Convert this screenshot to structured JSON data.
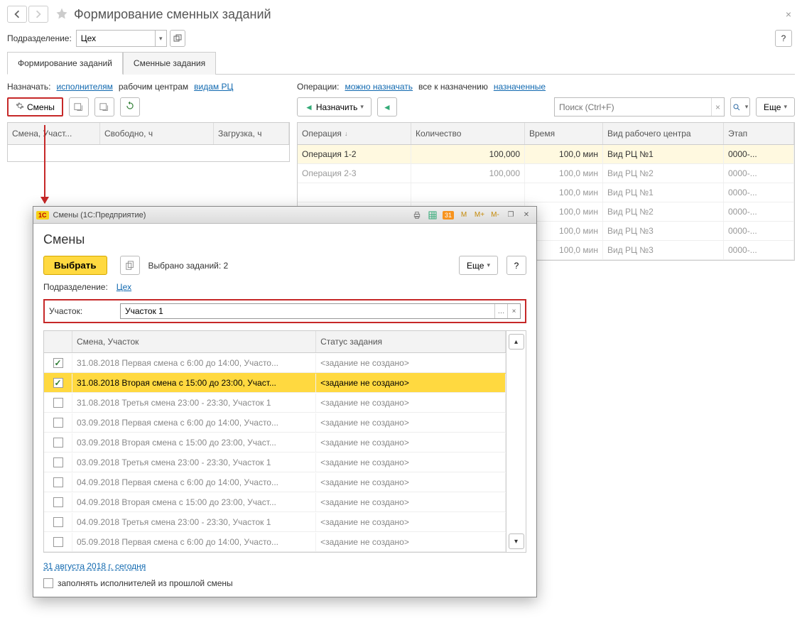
{
  "page": {
    "title": "Формирование сменных заданий",
    "close": "×"
  },
  "filter": {
    "label": "Подразделение:",
    "value": "Цех"
  },
  "help": "?",
  "tabs": {
    "tab1": "Формирование заданий",
    "tab2": "Сменные задания"
  },
  "left": {
    "assign_label": "Назначать:",
    "link_performers": "исполнителям",
    "link_workcenters": "рабочим центрам",
    "link_rctype": "видам РЦ",
    "btn_smeny": "Смены",
    "columns": {
      "shift": "Смена, Участ...",
      "free": "Свободно, ч",
      "load": "Загрузка, ч"
    }
  },
  "right": {
    "ops_label": "Операции:",
    "link_can_assign": "можно назначать",
    "txt_all": "все к назначению",
    "link_assigned": "назначенные",
    "btn_assign": "Назначить",
    "search_placeholder": "Поиск (Ctrl+F)",
    "btn_more": "Еще",
    "columns": {
      "op": "Операция",
      "qty": "Количество",
      "time": "Время",
      "rctype": "Вид рабочего центра",
      "stage": "Этап"
    },
    "rows": [
      {
        "op": "Операция 1-2",
        "qty": "100,000",
        "time": "100,0 мин",
        "rc": "Вид РЦ №1",
        "stage": "0000-...",
        "hl": true
      },
      {
        "op": "Операция 2-3",
        "qty": "100,000",
        "time": "100,0 мин",
        "rc": "Вид РЦ №2",
        "stage": "0000-..."
      },
      {
        "op": "",
        "qty": "",
        "time": "100,0 мин",
        "rc": "Вид РЦ №1",
        "stage": "0000-..."
      },
      {
        "op": "",
        "qty": "",
        "time": "100,0 мин",
        "rc": "Вид РЦ №2",
        "stage": "0000-..."
      },
      {
        "op": "",
        "qty": "",
        "time": "100,0 мин",
        "rc": "Вид РЦ №3",
        "stage": "0000-..."
      },
      {
        "op": "",
        "qty": "",
        "time": "100,0 мин",
        "rc": "Вид РЦ №3",
        "stage": "0000-..."
      }
    ]
  },
  "modal": {
    "title_bar": "Смены  (1С:Предприятие)",
    "heading": "Смены",
    "btn_select": "Выбрать",
    "selected_label": "Выбрано заданий: 2",
    "btn_more": "Еще",
    "help": "?",
    "podr_label": "Подразделение:",
    "podr_link": "Цех",
    "area_label": "Участок:",
    "area_value": "Участок 1",
    "columns": {
      "shift": "Смена, Участок",
      "status": "Статус задания"
    },
    "rows": [
      {
        "chk": true,
        "shift": "31.08.2018 Первая смена с 6:00 до 14:00, Участо...",
        "status": "<задание не создано>",
        "grey": true
      },
      {
        "chk": true,
        "shift": "31.08.2018 Вторая смена с 15:00 до 23:00, Участ...",
        "status": "<задание не создано>",
        "yellow": true
      },
      {
        "chk": false,
        "shift": "31.08.2018 Третья смена 23:00 - 23:30, Участок 1",
        "status": "<задание не создано>",
        "grey": true
      },
      {
        "chk": false,
        "shift": "03.09.2018 Первая смена с 6:00 до 14:00, Участо...",
        "status": "<задание не создано>",
        "grey": true
      },
      {
        "chk": false,
        "shift": "03.09.2018 Вторая смена с 15:00 до 23:00, Участ...",
        "status": "<задание не создано>",
        "grey": true
      },
      {
        "chk": false,
        "shift": "03.09.2018 Третья смена 23:00 - 23:30, Участок 1",
        "status": "<задание не создано>",
        "grey": true
      },
      {
        "chk": false,
        "shift": "04.09.2018 Первая смена с 6:00 до 14:00, Участо...",
        "status": "<задание не создано>",
        "grey": true
      },
      {
        "chk": false,
        "shift": "04.09.2018 Вторая смена с 15:00 до 23:00, Участ...",
        "status": "<задание не создано>",
        "grey": true
      },
      {
        "chk": false,
        "shift": "04.09.2018 Третья смена 23:00 - 23:30, Участок 1",
        "status": "<задание не создано>",
        "grey": true
      },
      {
        "chk": false,
        "shift": "05.09.2018 Первая смена с 6:00 до 14:00, Участо...",
        "status": "<задание не создано>",
        "grey": true
      }
    ],
    "date_link": "31 августа 2018 г. сегодня",
    "fill_checkbox_label": "заполнять исполнителей из прошлой смены",
    "tb_m": "M",
    "tb_mp": "M+",
    "tb_mm": "M-"
  }
}
